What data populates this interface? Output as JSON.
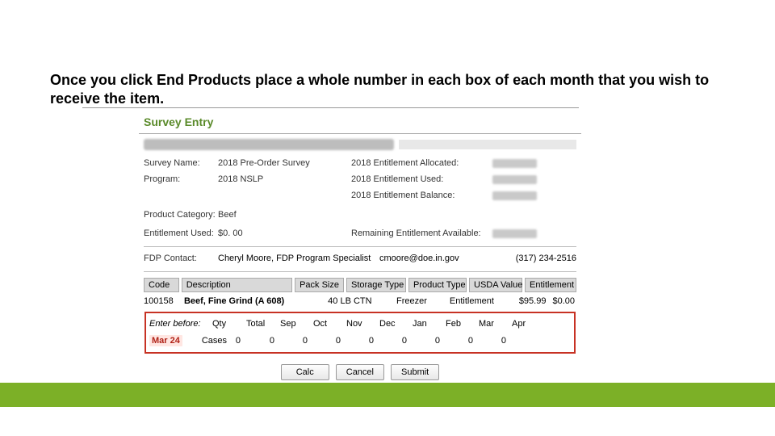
{
  "heading": "Once you click End Products place a whole number in each box of each month that you wish to receive the item.",
  "panel": {
    "title": "Survey Entry",
    "rows": {
      "survey_name_lab": "Survey Name:",
      "survey_name_val": "2018 Pre-Order Survey",
      "ent_alloc_lab": "2018 Entitlement Allocated:",
      "program_lab": "Program:",
      "program_val": "2018 NSLP",
      "ent_used_lab": "2018 Entitlement Used:",
      "ent_bal_lab": "2018 Entitlement Balance:",
      "prod_cat_lab": "Product Category:",
      "prod_cat_val": "Beef",
      "eu_lab": "Entitlement Used:",
      "eu_val": "$0. 00",
      "rem_lab": "Remaining Entitlement Available:"
    },
    "contact": {
      "lab": "FDP Contact:",
      "name": "Cheryl Moore, FDP Program Specialist",
      "email": "cmoore@doe.in.gov",
      "phone": "(317) 234-2516"
    },
    "cols": {
      "code": "Code",
      "desc": "Description",
      "pack": "Pack Size",
      "stor": "Storage Type",
      "prod": "Product Type",
      "usda": "USDA Value",
      "ent": "Entitlement"
    },
    "row": {
      "code": "100158",
      "desc": "Beef, Fine Grind (A 608)",
      "pack": "40 LB CTN",
      "stor": "Freezer",
      "prod": "Entitlement",
      "usda": "$95.99",
      "ent": "$0.00"
    },
    "red": {
      "enter_before_lab": "Enter before:",
      "enter_before_val": "Mar 24",
      "qty_lab": "Qty",
      "total_lab": "Total",
      "cases_lab": "Cases",
      "total_val": "0",
      "months": [
        "Sep",
        "Oct",
        "Nov",
        "Dec",
        "Jan",
        "Feb",
        "Mar",
        "Apr"
      ],
      "vals": [
        "0",
        "0",
        "0",
        "0",
        "0",
        "0",
        "0",
        "0"
      ]
    },
    "buttons": {
      "calc": "Calc",
      "cancel": "Cancel",
      "submit": "Submit"
    }
  }
}
